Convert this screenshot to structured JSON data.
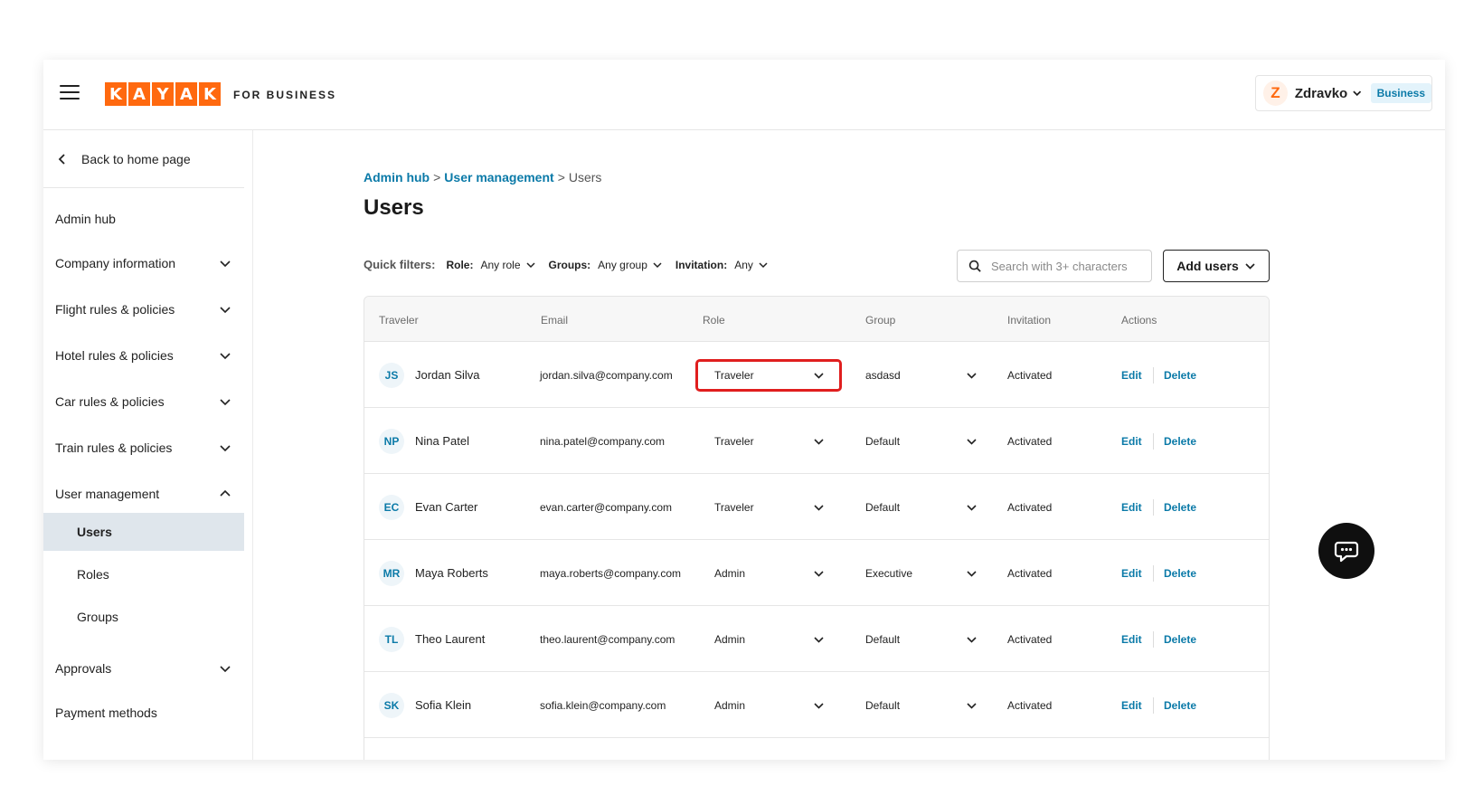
{
  "header": {
    "logo_letters": [
      "K",
      "A",
      "Y",
      "A",
      "K"
    ],
    "for_business": "FOR BUSINESS",
    "account": {
      "initial": "Z",
      "name": "Zdravko",
      "badge": "Business"
    }
  },
  "sidebar": {
    "back_label": "Back to home page",
    "items": [
      {
        "label": "Admin hub",
        "chevron": "none"
      },
      {
        "label": "Company information",
        "chevron": "down"
      },
      {
        "label": "Flight rules & policies",
        "chevron": "down"
      },
      {
        "label": "Hotel rules & policies",
        "chevron": "down"
      },
      {
        "label": "Car rules & policies",
        "chevron": "down"
      },
      {
        "label": "Train rules & policies",
        "chevron": "down"
      },
      {
        "label": "User management",
        "chevron": "up"
      },
      {
        "label": "Approvals",
        "chevron": "down"
      },
      {
        "label": "Payment methods",
        "chevron": "none"
      }
    ],
    "sub_items": [
      {
        "label": "Users",
        "active": true
      },
      {
        "label": "Roles",
        "active": false
      },
      {
        "label": "Groups",
        "active": false
      }
    ]
  },
  "breadcrumb": {
    "admin_hub": "Admin hub",
    "user_management": "User management",
    "current": "Users",
    "separator": ">"
  },
  "page_title": "Users",
  "filters": {
    "label": "Quick filters:",
    "role": {
      "name": "Role:",
      "value": "Any role"
    },
    "groups": {
      "name": "Groups:",
      "value": "Any group"
    },
    "invitation": {
      "name": "Invitation:",
      "value": "Any"
    }
  },
  "search": {
    "placeholder": "Search with 3+ characters",
    "value": ""
  },
  "add_users_label": "Add users",
  "table": {
    "columns": [
      "Traveler",
      "Email",
      "Role",
      "Group",
      "Invitation",
      "Actions"
    ],
    "rows": [
      {
        "initials": "JS",
        "name": "Jordan Silva",
        "email": "jordan.silva@company.com",
        "role": "Traveler",
        "group": "asdasd",
        "invitation": "Activated",
        "edit": "Edit",
        "delete": "Delete"
      },
      {
        "initials": "NP",
        "name": "Nina Patel",
        "email": "nina.patel@company.com",
        "role": "Traveler",
        "group": "Default",
        "invitation": "Activated",
        "edit": "Edit",
        "delete": "Delete"
      },
      {
        "initials": "EC",
        "name": "Evan Carter",
        "email": "evan.carter@company.com",
        "role": "Traveler",
        "group": "Default",
        "invitation": "Activated",
        "edit": "Edit",
        "delete": "Delete"
      },
      {
        "initials": "MR",
        "name": "Maya Roberts",
        "email": "maya.roberts@company.com",
        "role": "Admin",
        "group": "Executive",
        "invitation": "Activated",
        "edit": "Edit",
        "delete": "Delete"
      },
      {
        "initials": "TL",
        "name": "Theo Laurent",
        "email": "theo.laurent@company.com",
        "role": "Admin",
        "group": "Default",
        "invitation": "Activated",
        "edit": "Edit",
        "delete": "Delete"
      },
      {
        "initials": "SK",
        "name": "Sofia Klein",
        "email": "sofia.klein@company.com",
        "role": "Admin",
        "group": "Default",
        "invitation": "Activated",
        "edit": "Edit",
        "delete": "Delete"
      }
    ]
  },
  "icons": {
    "menu": "hamburger-icon",
    "back": "chevron-left-icon",
    "search": "search-icon",
    "chat": "chat-bubble-icon"
  },
  "colors": {
    "brand": "#ff690f",
    "link": "#0b7aa8",
    "highlight": "#e01e1e",
    "active_nav": "#dfe6ec"
  }
}
